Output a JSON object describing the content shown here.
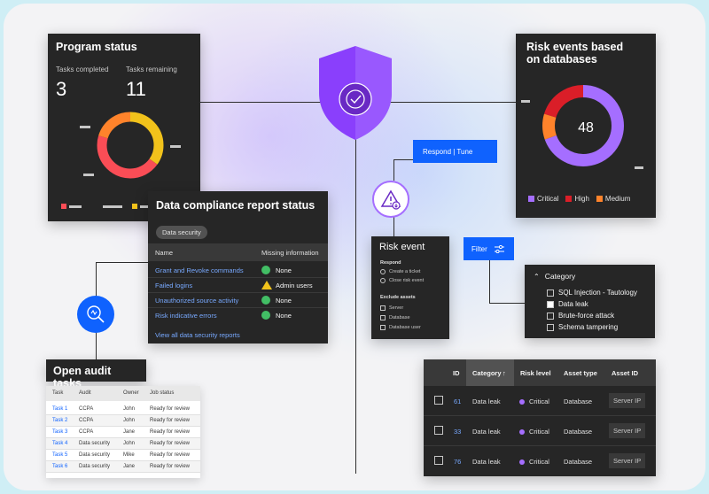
{
  "program_status": {
    "title": "Program status",
    "tasks_completed_label": "Tasks completed",
    "tasks_completed_value": "3",
    "tasks_remaining_label": "Tasks remaining",
    "tasks_remaining_value": "11"
  },
  "risk_events": {
    "title_line1": "Risk events based",
    "title_line2": "on databases",
    "center_value": "48",
    "legend": [
      {
        "label": "Critical",
        "color": "#a56eff"
      },
      {
        "label": "High",
        "color": "#da1e28"
      },
      {
        "label": "Medium",
        "color": "#ff832b"
      }
    ]
  },
  "compliance": {
    "title": "Data compliance report status",
    "chip": "Data security",
    "col_name": "Name",
    "col_missing": "Missing information",
    "rows": [
      {
        "name": "Grant and Revoke commands",
        "status": "None",
        "icon": "check-icon"
      },
      {
        "name": "Failed logins",
        "status": "Admin users",
        "icon": "warning-icon"
      },
      {
        "name": "Unauthorized source activity",
        "status": "None",
        "icon": "check-icon"
      },
      {
        "name": "Risk indicative errors",
        "status": "None",
        "icon": "check-icon"
      }
    ],
    "view_all": "View all data security reports"
  },
  "audit": {
    "title": "Open audit tasks",
    "headers": {
      "task": "Task",
      "audit": "Audit",
      "owner": "Owner",
      "status": "Job status"
    },
    "rows": [
      {
        "task": "Task 1",
        "audit": "CCPA",
        "owner": "John",
        "status": "Ready for review"
      },
      {
        "task": "Task 2",
        "audit": "CCPA",
        "owner": "John",
        "status": "Ready for review"
      },
      {
        "task": "Task 3",
        "audit": "CCPA",
        "owner": "Jane",
        "status": "Ready for review"
      },
      {
        "task": "Task 4",
        "audit": "Data security",
        "owner": "John",
        "status": "Ready for review"
      },
      {
        "task": "Task 5",
        "audit": "Data security",
        "owner": "Mike",
        "status": "Ready for review"
      },
      {
        "task": "Task 6",
        "audit": "Data security",
        "owner": "Jane",
        "status": "Ready for review"
      }
    ]
  },
  "respond_button": "Respond | Tune",
  "filter_button": "Filter",
  "risk_event": {
    "title": "Risk event",
    "respond_label": "Respond",
    "respond_options": [
      "Create a ticket",
      "Close risk event"
    ],
    "exclude_label": "Exclude assets",
    "exclude_options": [
      "Server",
      "Database",
      "Database user"
    ]
  },
  "category_panel": {
    "title": "Category",
    "options": [
      {
        "label": "SQL Injection - Tautology",
        "checked": false
      },
      {
        "label": "Data leak",
        "checked": true
      },
      {
        "label": "Brute-force attack",
        "checked": false
      },
      {
        "label": "Schema tampering",
        "checked": false
      }
    ]
  },
  "risk_table": {
    "headers": {
      "id": "ID",
      "category": "Category",
      "risk": "Risk level",
      "asset_type": "Asset type",
      "asset_id": "Asset ID"
    },
    "rows": [
      {
        "id": "61",
        "category": "Data leak",
        "risk": "Critical",
        "asset_type": "Database",
        "asset_id": "Server IP"
      },
      {
        "id": "33",
        "category": "Data leak",
        "risk": "Critical",
        "asset_type": "Database",
        "asset_id": "Server IP"
      },
      {
        "id": "76",
        "category": "Data leak",
        "risk": "Critical",
        "asset_type": "Database",
        "asset_id": "Server IP"
      }
    ]
  },
  "colors": {
    "critical": "#a56eff",
    "high": "#da1e28",
    "medium": "#ff832b",
    "yellow": "#f1c21b",
    "blue": "#0f62fe",
    "check": "#42be65"
  }
}
